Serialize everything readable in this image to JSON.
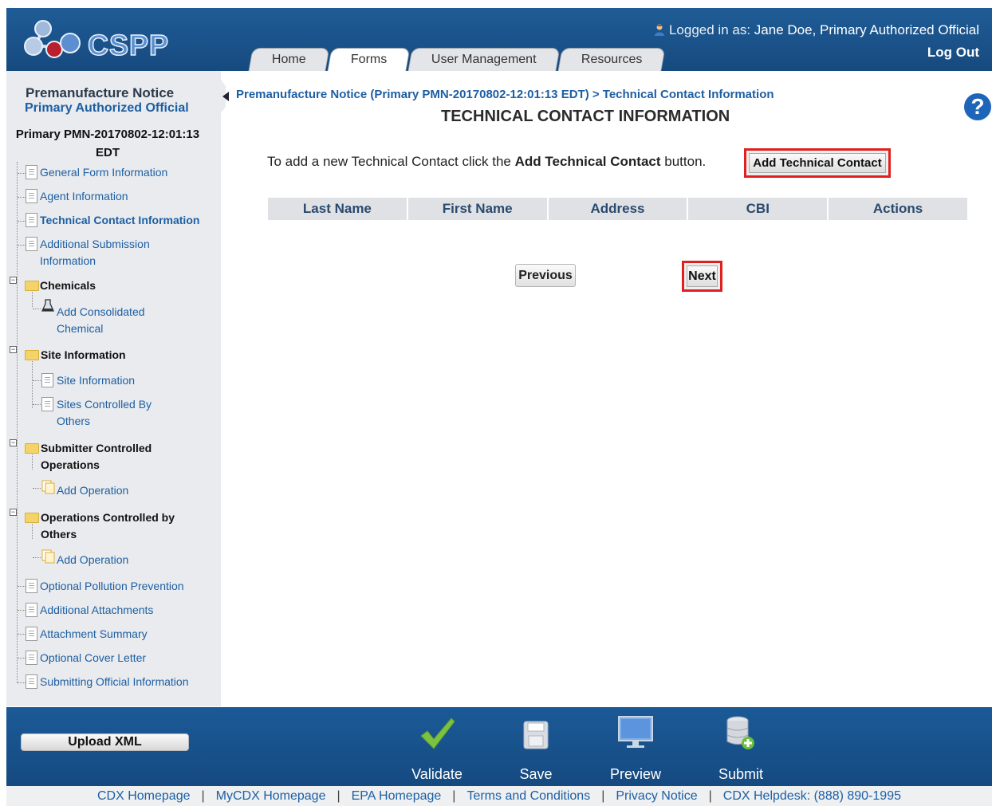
{
  "app": {
    "logo_text": "CSPP"
  },
  "header": {
    "login_prefix": "Logged in as:",
    "user_name": "Jane Doe, Primary Authorized Official",
    "logout": "Log Out",
    "tabs": [
      {
        "label": "Home",
        "active": false
      },
      {
        "label": "Forms",
        "active": true
      },
      {
        "label": "User Management",
        "active": false
      },
      {
        "label": "Resources",
        "active": false
      }
    ]
  },
  "sidebar": {
    "title": "Premanufacture Notice",
    "subtitle": "Primary Authorized Official",
    "pmn_id": "Primary PMN-20170802-12:01:13 EDT",
    "items": [
      {
        "label": "General Form Information"
      },
      {
        "label": "Agent Information"
      },
      {
        "label": "Technical Contact Information"
      },
      {
        "label": "Additional Submission Information"
      },
      {
        "label": "Chemicals"
      },
      {
        "label": "Add Consolidated Chemical"
      },
      {
        "label": "Site Information"
      },
      {
        "label": "Site Information"
      },
      {
        "label": "Sites Controlled By Others"
      },
      {
        "label": "Submitter Controlled Operations"
      },
      {
        "label": "Add Operation"
      },
      {
        "label": "Operations Controlled by Others"
      },
      {
        "label": "Add Operation"
      },
      {
        "label": "Optional Pollution Prevention"
      },
      {
        "label": "Additional Attachments"
      },
      {
        "label": "Attachment Summary"
      },
      {
        "label": "Optional Cover Letter"
      },
      {
        "label": "Submitting Official Information"
      }
    ]
  },
  "main": {
    "breadcrumb": "Premanufacture Notice (Primary PMN-20170802-12:01:13 EDT) > Technical Contact Information",
    "title": "TECHNICAL CONTACT INFORMATION",
    "instruction_pre": "To add a new Technical Contact click the",
    "instruction_bold": "Add Technical Contact",
    "instruction_post": "button.",
    "add_button": "Add Technical Contact",
    "columns": [
      "Last Name",
      "First Name",
      "Address",
      "CBI",
      "Actions"
    ],
    "previous": "Previous",
    "next": "Next"
  },
  "toolbar": {
    "upload": "Upload XML",
    "validate": "Validate",
    "save": "Save",
    "preview": "Preview",
    "submit": "Submit"
  },
  "footer_links": [
    "CDX Homepage",
    "MyCDX Homepage",
    "EPA Homepage",
    "Terms and Conditions",
    "Privacy Notice",
    "CDX Helpdesk: (888) 890-1995"
  ],
  "colors": {
    "header_blue": "#1f5c96",
    "link_blue": "#1d5fa3",
    "highlight_red": "#e02020",
    "sidebar_gray": "#e9ebee"
  }
}
